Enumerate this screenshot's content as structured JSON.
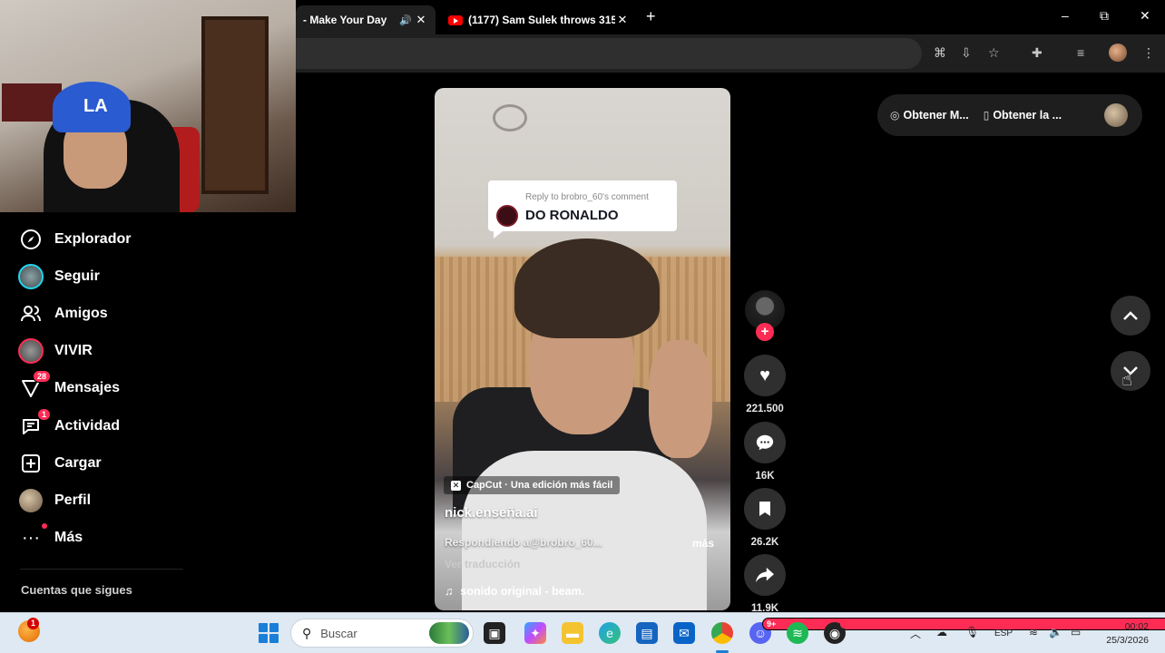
{
  "browser": {
    "tabs": [
      {
        "title": "- Make Your Day",
        "active": true,
        "audio": true
      },
      {
        "title": "(1177) Sam Sulek throws 315 -",
        "active": false,
        "audio": false
      }
    ],
    "new_tab_label": "+",
    "window_controls": {
      "minimize": "–",
      "restore": "⧉",
      "close": "✕"
    }
  },
  "sidebar": {
    "items": [
      {
        "label": "Explorador",
        "icon": "compass-icon"
      },
      {
        "label": "Seguir",
        "icon": "avatar"
      },
      {
        "label": "Amigos",
        "icon": "friends-icon"
      },
      {
        "label": "VIVIR",
        "icon": "live-avatar"
      },
      {
        "label": "Mensajes",
        "icon": "inbox-icon",
        "badge": "28"
      },
      {
        "label": "Actividad",
        "icon": "activity-icon",
        "badge": "1"
      },
      {
        "label": "Cargar",
        "icon": "upload-icon"
      },
      {
        "label": "Perfil",
        "icon": "profile-avatar"
      },
      {
        "label": "Más",
        "icon": "more-icon"
      }
    ],
    "following_title": "Cuentas que sigues"
  },
  "video": {
    "reply_meta": "Reply to brobro_60's comment",
    "reply_text": "DO RONALDO",
    "capcut_tag": "CapCut · Una edición más fácil",
    "author": "nick.enseña.ai",
    "description": "Respondiendo a@brobro_60...",
    "more_label": "más",
    "translate_label": "Ver traducción",
    "music": "sonido original - beam."
  },
  "actions": {
    "likes": "221.500",
    "comments": "16K",
    "saves": "26.2K",
    "shares": "11.9K"
  },
  "top_pill": {
    "item1": "Obtener M...",
    "item2": "Obtener la ..."
  },
  "taskbar": {
    "weather_badge": "1",
    "search_placeholder": "Buscar",
    "discord_badge": "9+",
    "language": "ESP",
    "time": "00:02",
    "date": "25/3/2026"
  },
  "colors": {
    "accent": "#fe2c55",
    "live_ring": "#20d5ec",
    "background": "#000000"
  }
}
